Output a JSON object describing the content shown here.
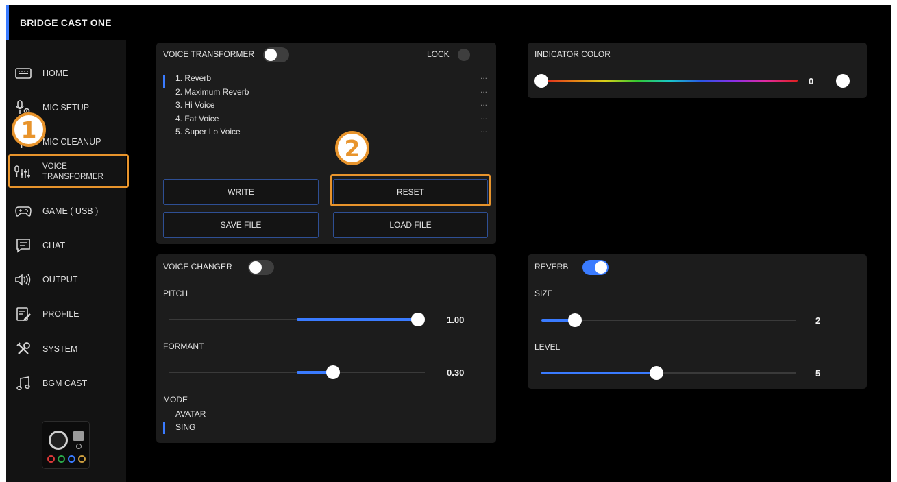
{
  "app": {
    "title": "BRIDGE CAST ONE"
  },
  "sidebar": {
    "items": [
      {
        "id": "home",
        "label": "HOME",
        "icon": "keyboard-icon"
      },
      {
        "id": "mic-setup",
        "label": "MIC SETUP",
        "icon": "microphone-settings-icon"
      },
      {
        "id": "mic-cleanup",
        "label": "MIC CLEANUP",
        "icon": "microphone-cleanup-icon"
      },
      {
        "id": "voice-transformer",
        "label_line1": "VOICE",
        "label_line2": "TRANSFORMER",
        "icon": "microphone-mixer-icon",
        "active": true
      },
      {
        "id": "game-usb",
        "label": "GAME ( USB )",
        "icon": "gamepad-icon"
      },
      {
        "id": "chat",
        "label": "CHAT",
        "icon": "chat-icon"
      },
      {
        "id": "output",
        "label": "OUTPUT",
        "icon": "speaker-icon"
      },
      {
        "id": "profile",
        "label": "PROFILE",
        "icon": "profile-icon"
      },
      {
        "id": "system",
        "label": "SYSTEM",
        "icon": "tools-icon"
      },
      {
        "id": "bgm-cast",
        "label": "BGM CAST",
        "icon": "music-note-icon"
      }
    ]
  },
  "callouts": {
    "step1": "1",
    "step2": "2"
  },
  "voice_transformer": {
    "title": "VOICE TRANSFORMER",
    "enabled": true,
    "lock_label": "LOCK",
    "lock_enabled": false,
    "presets": [
      {
        "name": "1. Reverb",
        "more": "...",
        "selected": true
      },
      {
        "name": "2. Maximum Reverb",
        "more": "..."
      },
      {
        "name": "3. Hi Voice",
        "more": "..."
      },
      {
        "name": "4. Fat Voice",
        "more": "..."
      },
      {
        "name": "5. Super Lo Voice",
        "more": "..."
      }
    ],
    "buttons": {
      "write": "WRITE",
      "reset": "RESET",
      "save_file": "SAVE FILE",
      "load_file": "LOAD FILE"
    }
  },
  "indicator_color": {
    "title": "INDICATOR COLOR",
    "value": "0",
    "position_fraction": 0.0
  },
  "voice_changer": {
    "title": "VOICE CHANGER",
    "enabled": false,
    "pitch": {
      "label": "PITCH",
      "value": "1.00",
      "fraction": 1.0
    },
    "formant": {
      "label": "FORMANT",
      "value": "0.30",
      "fraction": 0.65
    },
    "mode": {
      "label": "MODE",
      "options": [
        "AVATAR",
        "SING"
      ],
      "selected": "SING"
    }
  },
  "reverb": {
    "title": "REVERB",
    "enabled": true,
    "size": {
      "label": "SIZE",
      "value": "2",
      "fraction": 0.11
    },
    "level": {
      "label": "LEVEL",
      "value": "5",
      "fraction": 0.45
    }
  },
  "colors": {
    "accent": "#3a7bff",
    "callout": "#e8942c",
    "background": "#000000",
    "panel": "#1c1c1c"
  }
}
